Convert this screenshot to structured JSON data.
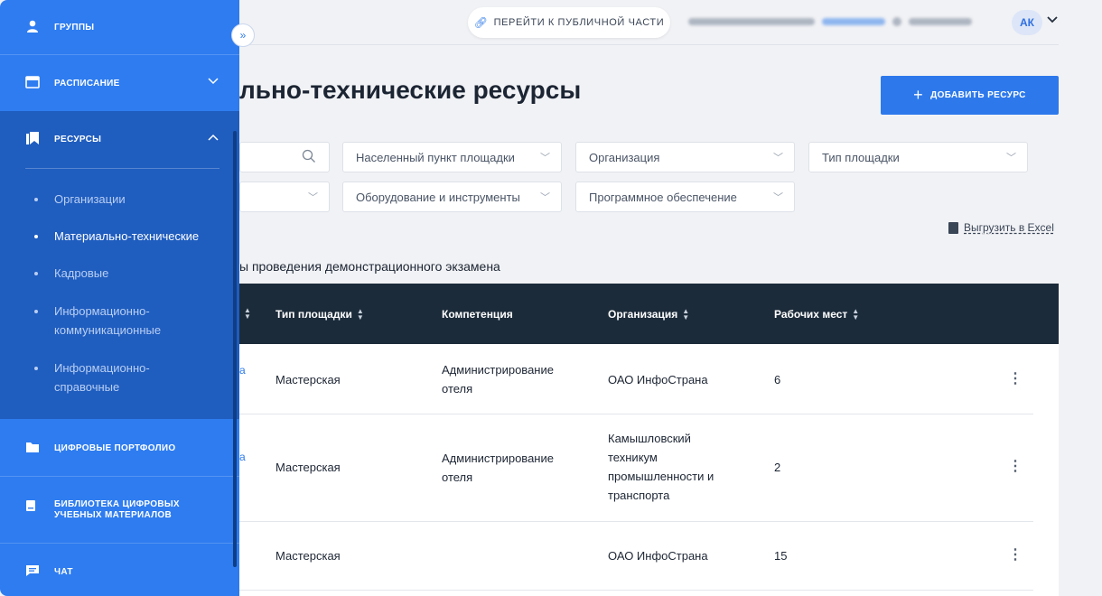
{
  "header": {
    "public_link": "ПЕРЕЙТИ К ПУБЛИЧНОЙ ЧАСТИ",
    "avatar": "АК"
  },
  "page": {
    "title": "льно-технические ресурсы",
    "add_button": "ДОБАВИТЬ РЕСУРС",
    "excel": "Выгрузить в Excel",
    "subheading": "ы проведения демонстрационного экзамена"
  },
  "filters": [
    {
      "label": ""
    },
    {
      "label": "Населенный пункт площадки"
    },
    {
      "label": "Организация"
    },
    {
      "label": "Тип площадки"
    },
    {
      "label": ""
    },
    {
      "label": "Оборудование и инструменты"
    },
    {
      "label": "Программное обеспечение"
    }
  ],
  "table": {
    "columns": [
      "Тип площадки",
      "Компетенция",
      "Организация",
      "Рабочих мест"
    ],
    "rows": [
      {
        "type": "Мастерская",
        "competence": "Администрирование отеля",
        "org": "ОАО ИнфоСтрана",
        "places": "6"
      },
      {
        "type": "Мастерская",
        "competence": "Администрирование отеля",
        "org": "Камышловский техникум промышленности и транспорта",
        "places": "2"
      },
      {
        "type": "Мастерская",
        "competence": "",
        "org": "ОАО ИнфоСтрана",
        "places": "15"
      }
    ]
  },
  "sidebar": {
    "items": [
      {
        "label": "ГРУППЫ",
        "icon": "user-icon"
      },
      {
        "label": "РАСПИСАНИЕ",
        "icon": "calendar-icon"
      },
      {
        "label": "РЕСУРСЫ",
        "icon": "bookmark-icon"
      },
      {
        "label": "ЦИФРОВЫЕ ПОРТФОЛИО",
        "icon": "folder-icon"
      },
      {
        "label": "БИБЛИОТЕКА ЦИФРОВЫХ УЧЕБНЫХ МАТЕРИАЛОВ",
        "icon": "book-icon"
      },
      {
        "label": "ЧАТ",
        "icon": "chat-icon"
      }
    ],
    "sub_items": [
      {
        "label": "Организации"
      },
      {
        "label": "Материально-технические"
      },
      {
        "label": "Кадровые"
      },
      {
        "label": "Информационно-коммуникационные"
      },
      {
        "label": "Информационно-справочные"
      }
    ]
  }
}
